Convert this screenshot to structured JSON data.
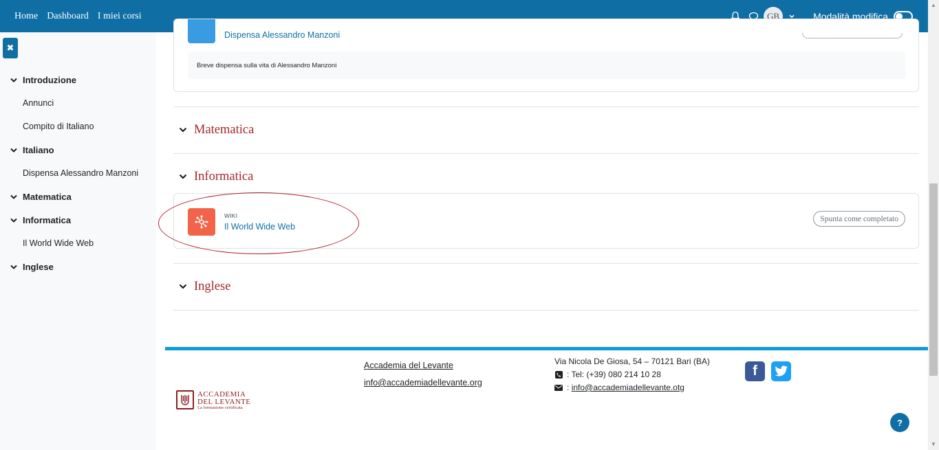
{
  "navbar": {
    "links": [
      "Home",
      "Dashboard",
      "I miei corsi"
    ],
    "avatar_initials": "GB",
    "edit_mode_label": "Modalità modifica",
    "edit_mode_on": false,
    "color": "#0f6fa5"
  },
  "drawer": {
    "items": [
      {
        "type": "section",
        "label": "Introduzione"
      },
      {
        "type": "item",
        "label": "Annunci"
      },
      {
        "type": "item",
        "label": "Compito di Italiano"
      },
      {
        "type": "section",
        "label": "Italiano"
      },
      {
        "type": "item",
        "label": "Dispensa Alessandro Manzoni"
      },
      {
        "type": "section",
        "label": "Matematica"
      },
      {
        "type": "section",
        "label": "Informatica"
      },
      {
        "type": "item",
        "label": "Il World Wide Web"
      },
      {
        "type": "section",
        "label": "Inglese"
      }
    ]
  },
  "main": {
    "top_activity": {
      "link": "Dispensa Alessandro Manzoni",
      "description": "Breve dispensa sulla vita di Alessandro Manzoni"
    },
    "sections": {
      "matematica": "Matematica",
      "informatica": "Informatica",
      "inglese": "Inglese"
    },
    "wiki": {
      "type_label": "WIKI",
      "link": "Il World Wide Web",
      "complete_button": "Spunta come completato"
    }
  },
  "footer": {
    "name": "Accademia del Levante",
    "email": "info@accademiadellevante.org",
    "address": "Via Nicola De Giosa, 54 – 70121 Bari (BA)",
    "phone": ": Tel: (+39) 080 214 10 28",
    "email_prefix": ":",
    "email2": "info@accademiadellevante.otg",
    "logo": {
      "line1": "ACCADEMIA",
      "line2": "DEL LEVANTE",
      "tagline": "La formazione certificata"
    },
    "social_colors": {
      "facebook": "#3b5998",
      "twitter": "#1da1f2"
    }
  },
  "help_label": "?"
}
